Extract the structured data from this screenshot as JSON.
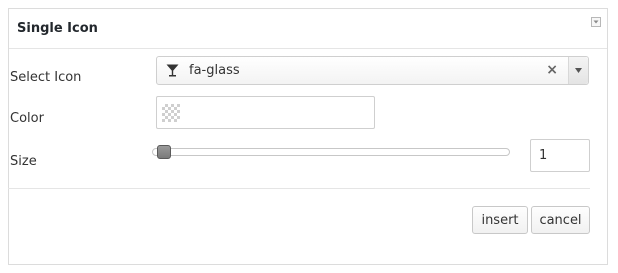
{
  "panel": {
    "title": "Single Icon",
    "collapse_icon": "collapse-arrow-icon"
  },
  "fields": {
    "icon_label": "Select Icon",
    "icon_select": {
      "icon": "glass-icon",
      "value": "fa-glass",
      "clear_symbol": "×",
      "arrow_icon": "dropdown-arrow-icon"
    },
    "color_label": "Color",
    "color_input": {
      "swatch": "transparent-checkerboard",
      "value": ""
    },
    "size_label": "Size",
    "size_slider": {
      "min": 1,
      "max": 100,
      "value": 1
    },
    "size_value": "1"
  },
  "buttons": {
    "insert": "insert",
    "cancel": "cancel"
  },
  "colors": {
    "border": "#dcdcdc",
    "text": "#333333",
    "handle": "#7a7a7a"
  }
}
